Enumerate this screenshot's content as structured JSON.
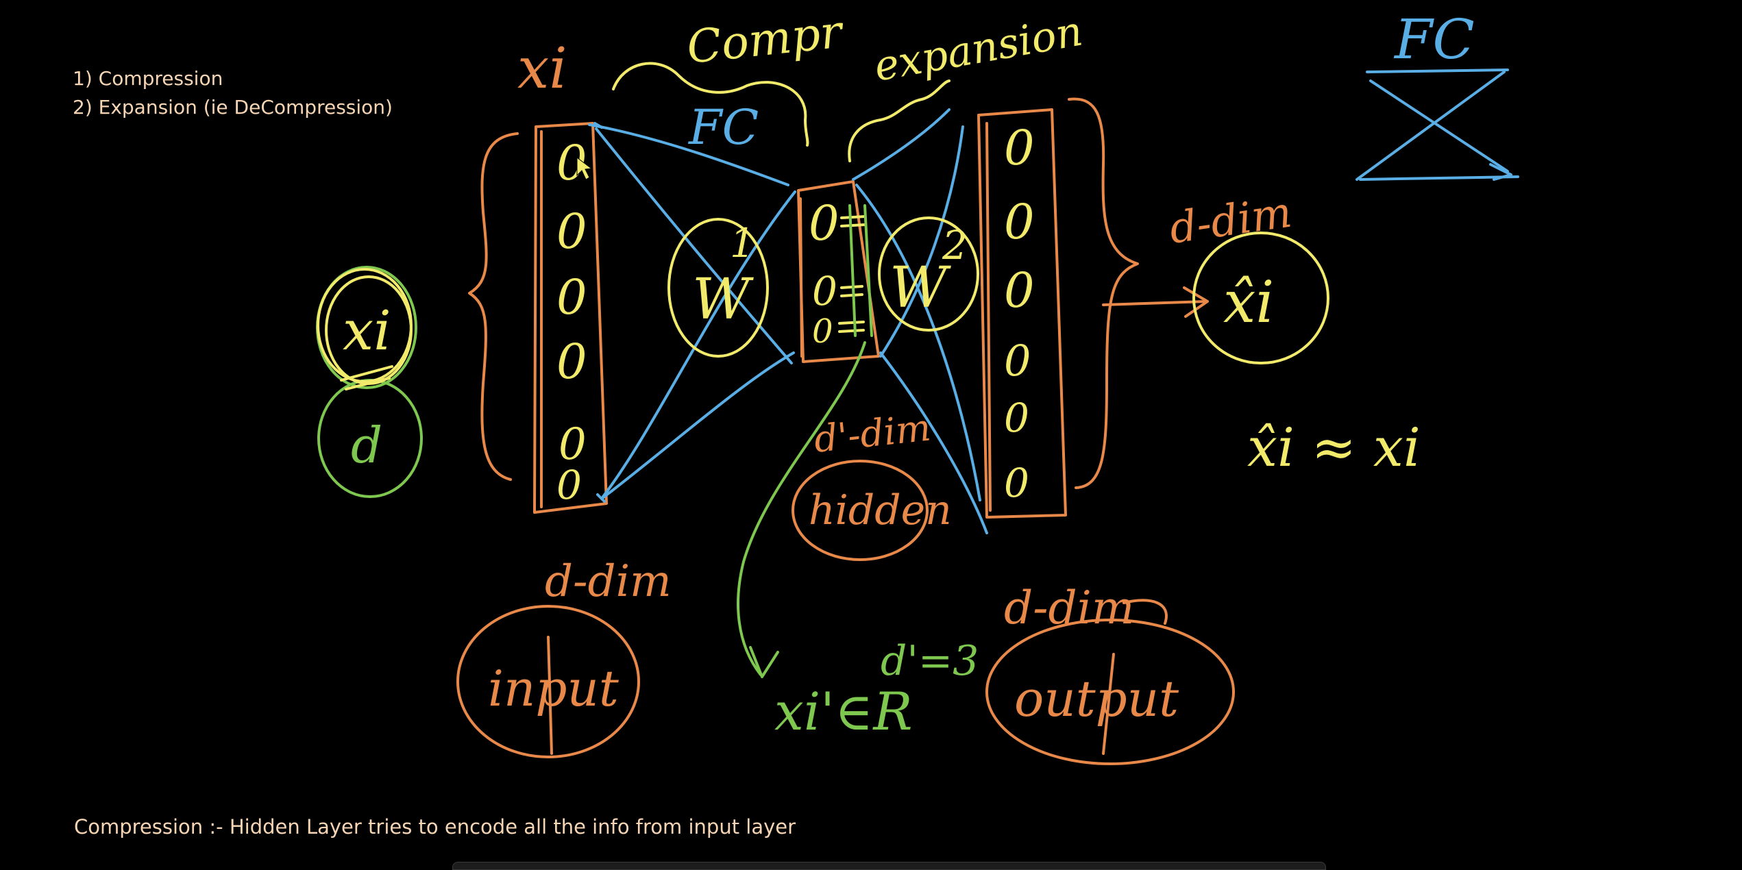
{
  "notes": {
    "list": [
      "1)  Compression",
      "2) Expansion (ie DeCompression)"
    ],
    "bottom": "Compression :- Hidden Layer tries to encode all the info from input layer"
  },
  "handwriting": {
    "xi_top": "xi",
    "compr": "Compr",
    "fc_mid": "FC",
    "expansion": "expansion",
    "fc_corner": "FC",
    "xi_left": "xi",
    "d_left": "d",
    "w1": "W",
    "w1_sup": "1",
    "w2": "W",
    "w2_sup": "2",
    "d_dim_right": "d-dim",
    "xi_hat_circle": "x̂i",
    "xi_hat_eq": "x̂i ≈ xi",
    "d_prime_dim": "d'-dim",
    "hidden": "hidden",
    "d_dim_input": "d-dim",
    "input": "input",
    "xi_prime_r": "xi'∈R",
    "d_prime_3": "d'=3",
    "d_dim_output": "d-dim",
    "output": "output"
  },
  "neurons": {
    "input_count": 6,
    "hidden_count": 3,
    "output_count": 6,
    "symbol": "0"
  },
  "colors": {
    "background": "#000000",
    "typed_text": "#f6d5b4",
    "orange": "#e8894a",
    "yellow": "#f2ea6b",
    "blue": "#5aaee6",
    "green": "#7ec850"
  }
}
